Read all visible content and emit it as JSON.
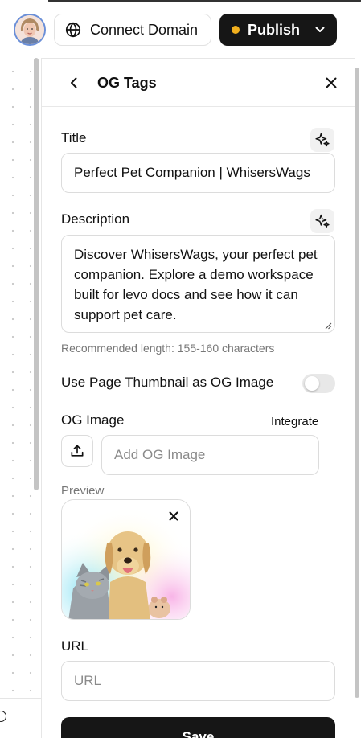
{
  "topbar": {
    "connect_domain_label": "Connect Domain",
    "publish_label": "Publish",
    "publish_status_color": "#f2b01e"
  },
  "panel": {
    "title": "OG Tags",
    "title_label": "Title",
    "title_value": "Perfect Pet Companion | WhisersWags",
    "description_label": "Description",
    "description_value": "Discover WhisersWags, your perfect pet companion. Explore a demo workspace built for levo docs and see how it can support pet care.",
    "description_hint": "Recommended length: 155-160 characters",
    "thumbnail_toggle_label": "Use Page Thumbnail as OG Image",
    "thumbnail_toggle_on": false,
    "og_image_label": "OG Image",
    "integrate_label": "Integrate",
    "og_image_placeholder": "Add OG Image",
    "preview_label": "Preview",
    "url_label": "URL",
    "url_placeholder": "URL",
    "save_label": "Save"
  },
  "icons": [
    "avatar",
    "globe-icon",
    "chevron-down-icon",
    "back-arrow-icon",
    "close-icon",
    "sparkle-icon",
    "resize-handle-icon",
    "upload-icon",
    "remove-icon",
    "preview-image"
  ],
  "colors": {
    "accent_dark": "#161616",
    "status_dot": "#f2b01e",
    "border": "#dcdcdc"
  }
}
